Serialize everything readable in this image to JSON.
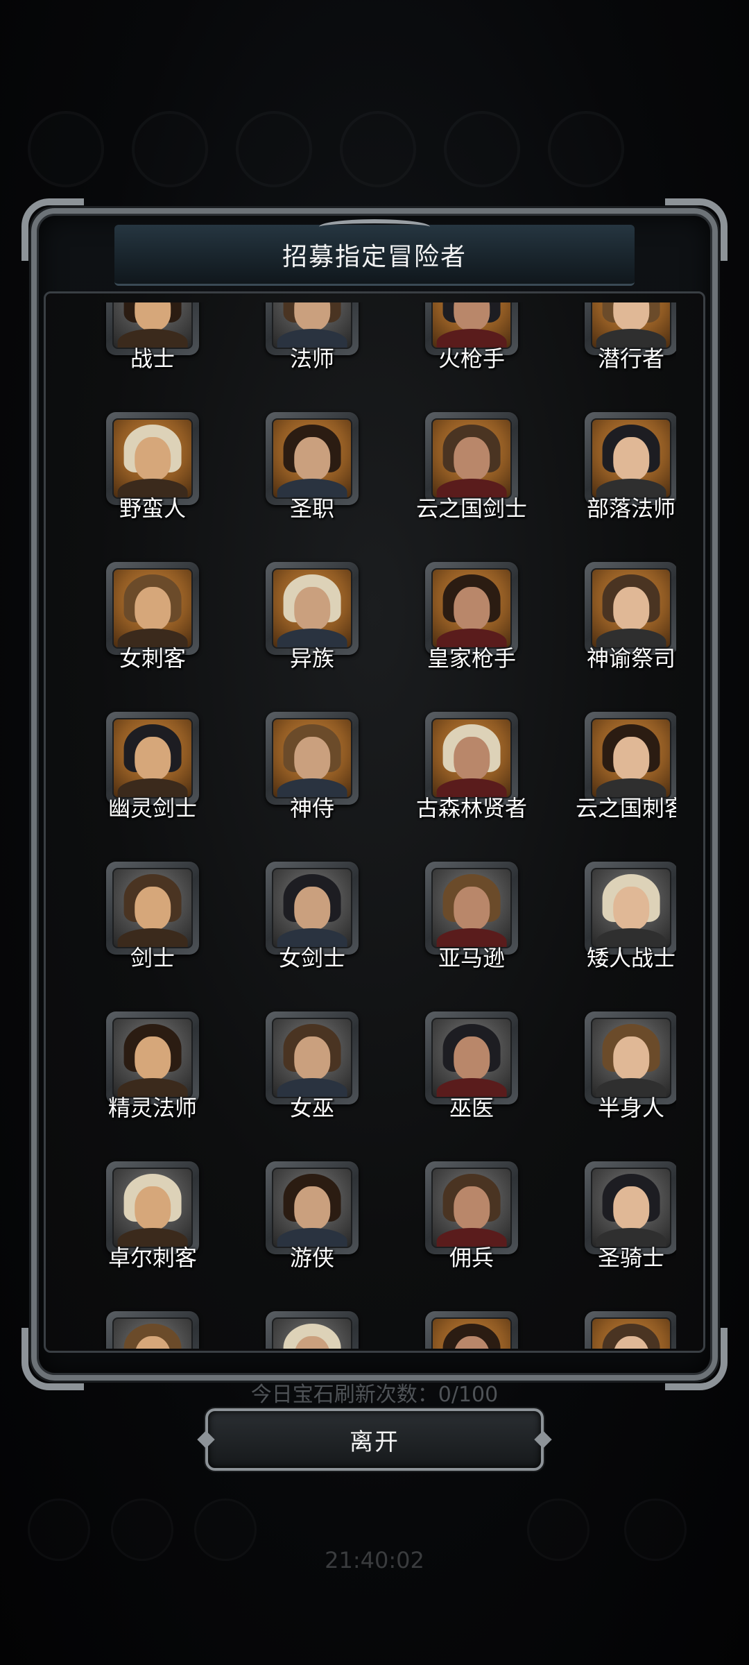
{
  "dialog": {
    "title": "招募指定冒险者"
  },
  "adventurers": [
    {
      "name": "战士",
      "tone": "grey"
    },
    {
      "name": "法师",
      "tone": "grey"
    },
    {
      "name": "火枪手",
      "tone": "gold"
    },
    {
      "name": "潜行者",
      "tone": "gold"
    },
    {
      "name": "野蛮人",
      "tone": "gold"
    },
    {
      "name": "圣职",
      "tone": "gold"
    },
    {
      "name": "云之国剑士",
      "tone": "gold"
    },
    {
      "name": "部落法师",
      "tone": "gold"
    },
    {
      "name": "女刺客",
      "tone": "gold"
    },
    {
      "name": "异族",
      "tone": "gold"
    },
    {
      "name": "皇家枪手",
      "tone": "gold"
    },
    {
      "name": "神谕祭司",
      "tone": "gold"
    },
    {
      "name": "幽灵剑士",
      "tone": "gold"
    },
    {
      "name": "神侍",
      "tone": "gold"
    },
    {
      "name": "古森林贤者",
      "tone": "gold"
    },
    {
      "name": "云之国刺客",
      "tone": "gold"
    },
    {
      "name": "剑士",
      "tone": "grey"
    },
    {
      "name": "女剑士",
      "tone": "grey"
    },
    {
      "name": "亚马逊",
      "tone": "grey"
    },
    {
      "name": "矮人战士",
      "tone": "grey"
    },
    {
      "name": "精灵法师",
      "tone": "grey"
    },
    {
      "name": "女巫",
      "tone": "grey"
    },
    {
      "name": "巫医",
      "tone": "grey"
    },
    {
      "name": "半身人",
      "tone": "grey"
    },
    {
      "name": "卓尔刺客",
      "tone": "grey"
    },
    {
      "name": "游侠",
      "tone": "grey"
    },
    {
      "name": "佣兵",
      "tone": "grey"
    },
    {
      "name": "圣骑士",
      "tone": "grey"
    },
    {
      "name": "",
      "tone": "grey"
    },
    {
      "name": "",
      "tone": "grey"
    },
    {
      "name": "",
      "tone": "gold"
    },
    {
      "name": "",
      "tone": "gold"
    }
  ],
  "footer": {
    "refresh_text": "今日宝石刷新次数：0/100",
    "exit_label": "离开"
  },
  "background": {
    "time_text": "21:40:02"
  },
  "colors": {
    "frame": "#8d9398",
    "title_bar": "#1a262e",
    "portrait_gold": "#c9853a",
    "portrait_grey": "#7a7a7a"
  }
}
